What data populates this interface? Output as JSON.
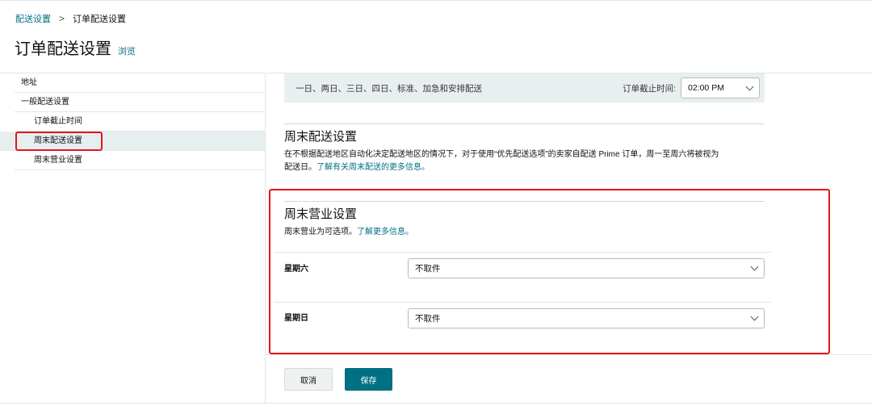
{
  "breadcrumb": {
    "parent": "配送设置",
    "separator": ">",
    "current": "订单配送设置"
  },
  "header": {
    "title": "订单配送设置",
    "preview_link": "浏览"
  },
  "sidebar": {
    "items": [
      {
        "label": "地址"
      },
      {
        "label": "一般配送设置"
      },
      {
        "label": "订单截止时间"
      },
      {
        "label": "周末配送设置",
        "active": true
      },
      {
        "label": "周末营业设置"
      }
    ]
  },
  "shipping_bar": {
    "speeds": "一日、两日、三日、四日、标准、加急和安排配送",
    "cutoff_label": "订单截止时间:",
    "cutoff_value": "02:00 PM"
  },
  "weekend_delivery": {
    "title": "周末配送设置",
    "description": "在不根据配送地区自动化决定配送地区的情况下，对于使用“优先配送选项”的卖家自配送 Prime 订单，周一至周六将被视为",
    "description_line2": "配送日。",
    "link": "了解有关周末配送的更多信息。"
  },
  "weekend_operation": {
    "title": "周末营业设置",
    "description": "周末营业为可选项。",
    "link": "了解更多信息。",
    "saturday_label": "星期六",
    "saturday_value": "不取件",
    "sunday_label": "星期日",
    "sunday_value": "不取件"
  },
  "actions": {
    "cancel": "取消",
    "save": "保存"
  },
  "colors": {
    "link": "#007185",
    "primary_button": "#007185",
    "highlight": "#e5161b",
    "active_sidebar": "#e6eff0"
  }
}
